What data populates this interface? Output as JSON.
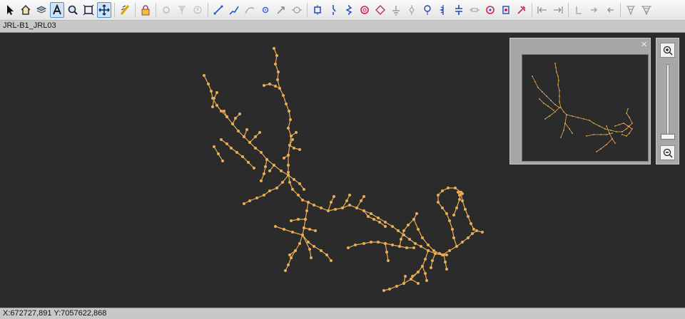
{
  "window": {
    "title": "JRL-B1_JRL03"
  },
  "status": {
    "coordinates": "X:672727,891 Y:7057622,868"
  },
  "colors": {
    "network": "#e8ad55",
    "background": "#2b2b2b",
    "panel": "#a7a7a7"
  },
  "toolbar": {
    "tools": [
      "select-arrow-icon",
      "home-icon",
      "layers-icon",
      "text-tool-icon",
      "zoom-window-icon",
      "zoom-extent-icon",
      "pan-icon",
      "measure-icon",
      "lock-icon",
      "node-icon",
      "tower-icon",
      "info-icon",
      "line-tool-icon",
      "polyline-icon",
      "curve-icon",
      "point-icon",
      "arrow-icon",
      "device-icon",
      "switch-icon",
      "breaker-icon",
      "resistor-icon",
      "transformer-icon",
      "ground-icon",
      "fuse-icon",
      "regulator-icon",
      "capacitor-icon",
      "reactor-icon",
      "generator-icon",
      "meter-icon",
      "fault-icon",
      "align-left-icon",
      "align-right-icon",
      "undo-icon",
      "redo-icon",
      "back-icon",
      "pylon-icon",
      "pylon-double-icon"
    ]
  },
  "overview": {
    "close_label": "×"
  }
}
